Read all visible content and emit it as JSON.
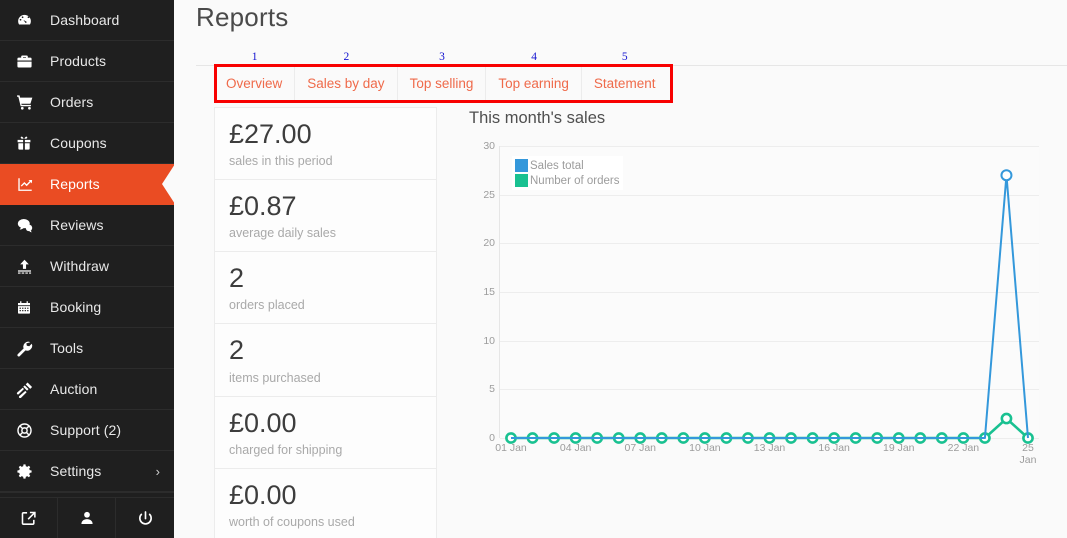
{
  "colors": {
    "sidebar_bg": "#1f1f1f",
    "accent_orange": "#ea4c23",
    "tab_text": "#ef6a4a",
    "annotation_red": "#f80000",
    "annotation_blue": "#1414d0",
    "series_sales": "#3498db",
    "series_orders": "#19c191"
  },
  "sidebar": {
    "items": [
      {
        "label": "Dashboard",
        "icon": "dashboard-icon",
        "active": false
      },
      {
        "label": "Products",
        "icon": "briefcase-icon",
        "active": false
      },
      {
        "label": "Orders",
        "icon": "cart-icon",
        "active": false
      },
      {
        "label": "Coupons",
        "icon": "gift-icon",
        "active": false
      },
      {
        "label": "Reports",
        "icon": "chart-line-icon",
        "active": true
      },
      {
        "label": "Reviews",
        "icon": "comment-icon",
        "active": false
      },
      {
        "label": "Withdraw",
        "icon": "upload-icon",
        "active": false
      },
      {
        "label": "Booking",
        "icon": "calendar-icon",
        "active": false
      },
      {
        "label": "Tools",
        "icon": "wrench-icon",
        "active": false
      },
      {
        "label": "Auction",
        "icon": "gavel-icon",
        "active": false
      },
      {
        "label": "Support (2)",
        "icon": "lifebuoy-icon",
        "active": false
      },
      {
        "label": "Settings",
        "icon": "gear-icon",
        "active": false,
        "chevron": "›"
      }
    ],
    "footer_icons": [
      "external-link-icon",
      "user-icon",
      "power-icon"
    ]
  },
  "header": {
    "title": "Reports"
  },
  "tabs": [
    {
      "label": "Overview",
      "number": "1",
      "active": true
    },
    {
      "label": "Sales by day",
      "number": "2",
      "active": false
    },
    {
      "label": "Top selling",
      "number": "3",
      "active": false
    },
    {
      "label": "Top earning",
      "number": "4",
      "active": false
    },
    {
      "label": "Statement",
      "number": "5",
      "active": false
    }
  ],
  "stats": [
    {
      "value": "£27.00",
      "caption": "sales in this period"
    },
    {
      "value": "£0.87",
      "caption": "average daily sales"
    },
    {
      "value": "2",
      "caption": "orders placed"
    },
    {
      "value": "2",
      "caption": "items purchased"
    },
    {
      "value": "£0.00",
      "caption": "charged for shipping"
    },
    {
      "value": "£0.00",
      "caption": "worth of coupons used"
    }
  ],
  "chart_data": {
    "type": "line",
    "title": "This month's sales",
    "xlabel": "",
    "ylabel": "",
    "ylim": [
      0,
      30
    ],
    "yticks": [
      0,
      5,
      10,
      15,
      20,
      25,
      30
    ],
    "grid": true,
    "legend_position": "top-left",
    "x": [
      "01 Jan",
      "02 Jan",
      "03 Jan",
      "04 Jan",
      "05 Jan",
      "06 Jan",
      "07 Jan",
      "08 Jan",
      "09 Jan",
      "10 Jan",
      "11 Jan",
      "12 Jan",
      "13 Jan",
      "14 Jan",
      "15 Jan",
      "16 Jan",
      "17 Jan",
      "18 Jan",
      "19 Jan",
      "20 Jan",
      "21 Jan",
      "22 Jan",
      "23 Jan",
      "24 Jan",
      "25 Jan"
    ],
    "xtick_labels": [
      "01 Jan",
      "04 Jan",
      "07 Jan",
      "10 Jan",
      "13 Jan",
      "16 Jan",
      "19 Jan",
      "22 Jan",
      "25\nJan"
    ],
    "xtick_indices": [
      0,
      3,
      6,
      9,
      12,
      15,
      18,
      21,
      24
    ],
    "series": [
      {
        "name": "Sales total",
        "color": "#3498db",
        "values": [
          0,
          0,
          0,
          0,
          0,
          0,
          0,
          0,
          0,
          0,
          0,
          0,
          0,
          0,
          0,
          0,
          0,
          0,
          0,
          0,
          0,
          0,
          0,
          27,
          0
        ]
      },
      {
        "name": "Number of orders",
        "color": "#19c191",
        "values": [
          0,
          0,
          0,
          0,
          0,
          0,
          0,
          0,
          0,
          0,
          0,
          0,
          0,
          0,
          0,
          0,
          0,
          0,
          0,
          0,
          0,
          0,
          0,
          2,
          0
        ]
      }
    ]
  }
}
